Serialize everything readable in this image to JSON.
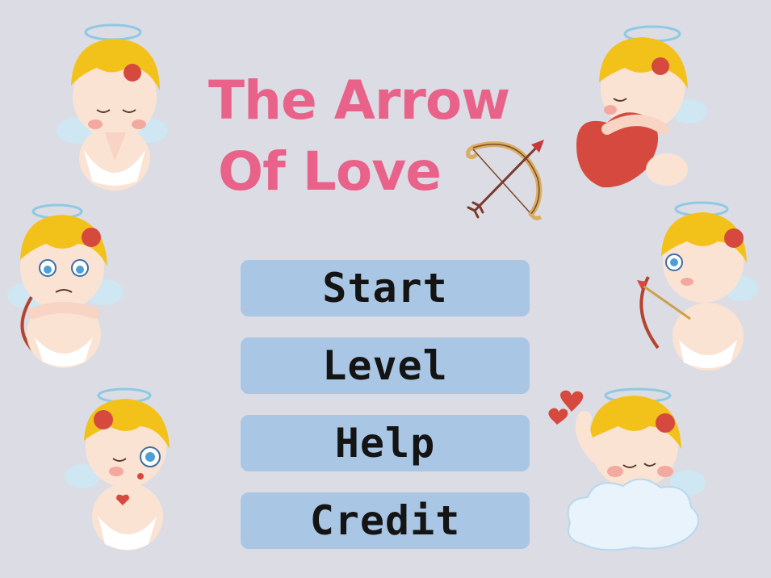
{
  "title": {
    "line1": "The Arrow",
    "line2": "Of Love",
    "color": "#e8628a"
  },
  "menu": {
    "button_color": "#a9c6e4",
    "items": [
      {
        "id": "start",
        "label": "Start"
      },
      {
        "id": "level",
        "label": "Level"
      },
      {
        "id": "help",
        "label": "Help"
      },
      {
        "id": "credit",
        "label": "Credit"
      }
    ]
  },
  "icons": {
    "title_decoration": "bow-and-arrow-icon",
    "characters": [
      "cupid-praying",
      "cupid-hugging-heart",
      "cupid-grumpy-with-bow",
      "cupid-aiming-bow",
      "cupid-blowing-kiss",
      "cupid-on-cloud"
    ]
  },
  "palette": {
    "background": "#dcdce4",
    "hair": "#f3c21a",
    "skin": "#fbe3d3",
    "wing": "#cfe6f3",
    "halo": "#8fc9e3",
    "heart_red": "#d6493e"
  }
}
